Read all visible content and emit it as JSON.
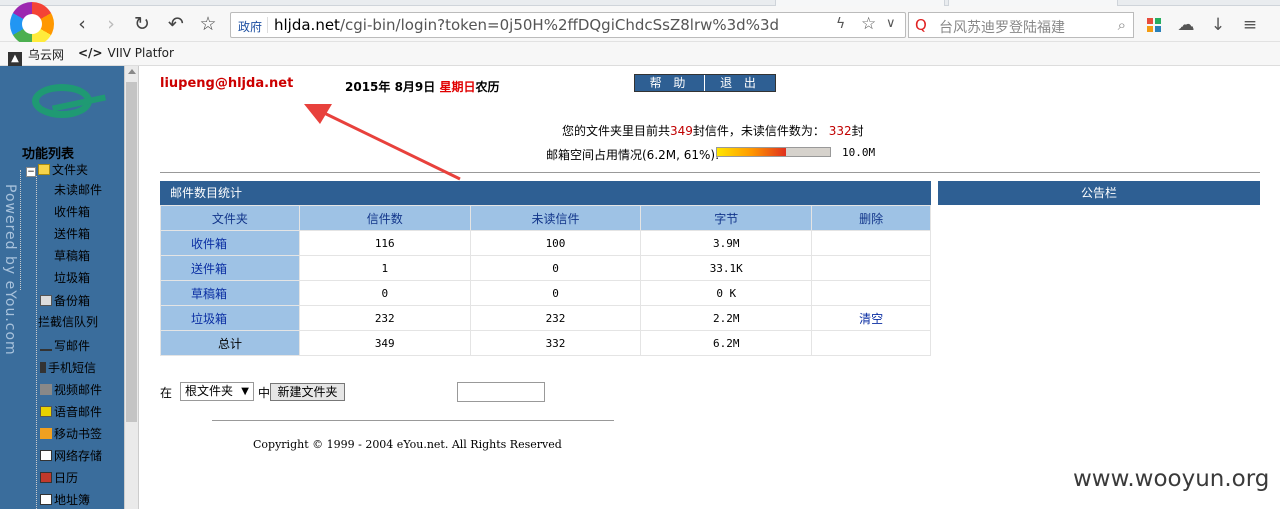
{
  "browser": {
    "gov_label": "政府",
    "url_host": "hljda.net",
    "url_path": "/cgi-bin/login?token=0j50H%2ffDQgiChdcSsZ8lrw%3d%3d",
    "search_placeholder": "台风苏迪罗登陆福建",
    "bookmarks": [
      {
        "label": "乌云网",
        "icon": "wooyun-icon"
      },
      {
        "label": "VIIV Platfor",
        "icon": "code-icon"
      }
    ]
  },
  "sidebar": {
    "vertical_text": "Powered by eYou.com",
    "menu_title": "功能列表",
    "folder_root": "文件夹",
    "folders": [
      "未读邮件",
      "收件箱",
      "送件箱",
      "草稿箱",
      "垃圾箱"
    ],
    "items": [
      "备份箱",
      "拦截信队列",
      "写邮件",
      "手机短信",
      "视频邮件",
      "语音邮件",
      "移动书签",
      "网络存储",
      "日历",
      "地址簿"
    ]
  },
  "header": {
    "email": "liupeng@hljda.net",
    "date_prefix": "2015年  8月9日",
    "weekday": "星期日",
    "calendar": "农历",
    "help_label": "帮 助",
    "logout_label": "退 出"
  },
  "summary": {
    "line1_pre": "您的文件夹里目前共",
    "total_count": "349",
    "line1_mid": "封信件，未读信件数为：",
    "unread_count": "332",
    "line1_post": "封",
    "usage_label": "邮箱空间占用情况(6.2M, 61%):",
    "usage_fraction": 0.61,
    "capacity": "10.0M"
  },
  "stats_panel": {
    "title": "邮件数目统计",
    "notice_title": "公告栏",
    "columns": [
      "文件夹",
      "信件数",
      "未读信件",
      "字节",
      "删除"
    ],
    "rows": [
      {
        "folder": "收件箱",
        "count": "116",
        "unread": "100",
        "bytes": "3.9M",
        "action": ""
      },
      {
        "folder": "送件箱",
        "count": "1",
        "unread": "0",
        "bytes": "33.1K",
        "action": ""
      },
      {
        "folder": "草稿箱",
        "count": "0",
        "unread": "0",
        "bytes": "0 K",
        "action": ""
      },
      {
        "folder": "垃圾箱",
        "count": "232",
        "unread": "232",
        "bytes": "2.2M",
        "action": "清空"
      }
    ],
    "total": {
      "folder": "总计",
      "count": "349",
      "unread": "332",
      "bytes": "6.2M",
      "action": ""
    }
  },
  "folder_form": {
    "in_label": "在",
    "select_value": "根文件夹",
    "middle_label": "中",
    "button_label": "新建文件夹"
  },
  "footer": {
    "copyright": "Copyright © 1999 - 2004 eYou.net. All Rights Reserved"
  },
  "watermark": "www.wooyun.org",
  "colors": {
    "sidebar": "#3a6d9c",
    "header_bar": "#2e5f93",
    "table_head": "#9ec2e5",
    "accent_red": "#cc0000",
    "annotation_arrow": "#e8413c"
  }
}
